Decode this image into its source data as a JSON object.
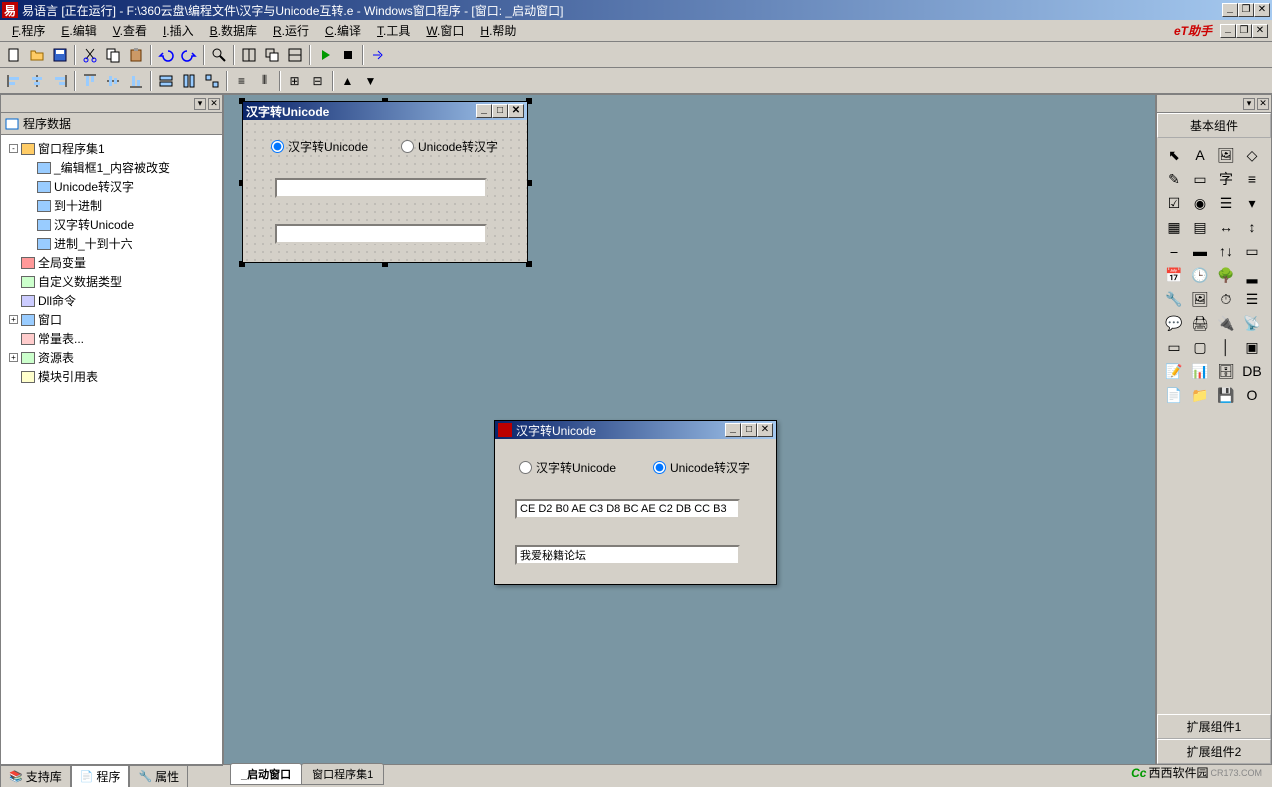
{
  "title": "易语言 [正在运行] - F:\\360云盘\\编程文件\\汉字与Unicode互转.e - Windows窗口程序 - [窗口: _启动窗口]",
  "menubar": {
    "items": [
      {
        "u": "F",
        "label": ".程序"
      },
      {
        "u": "E",
        "label": ".编辑"
      },
      {
        "u": "V",
        "label": ".查看"
      },
      {
        "u": "I",
        "label": ".插入"
      },
      {
        "u": "B",
        "label": ".数据库"
      },
      {
        "u": "R",
        "label": ".运行"
      },
      {
        "u": "C",
        "label": ".编译"
      },
      {
        "u": "T",
        "label": ".工具"
      },
      {
        "u": "W",
        "label": ".窗口"
      },
      {
        "u": "H",
        "label": ".帮助"
      }
    ],
    "helper": "eT助手"
  },
  "left_panel": {
    "title": "程序数据",
    "tree": [
      {
        "indent": 0,
        "toggle": "-",
        "icon": "folder",
        "label": "窗口程序集1"
      },
      {
        "indent": 1,
        "toggle": "",
        "icon": "sub",
        "label": "_编辑框1_内容被改变"
      },
      {
        "indent": 1,
        "toggle": "",
        "icon": "sub",
        "label": "Unicode转汉字"
      },
      {
        "indent": 1,
        "toggle": "",
        "icon": "sub",
        "label": "到十进制"
      },
      {
        "indent": 1,
        "toggle": "",
        "icon": "sub",
        "label": "汉字转Unicode"
      },
      {
        "indent": 1,
        "toggle": "",
        "icon": "sub",
        "label": "进制_十到十六"
      },
      {
        "indent": 0,
        "toggle": "",
        "icon": "var",
        "label": "全局变量"
      },
      {
        "indent": 0,
        "toggle": "",
        "icon": "type",
        "label": "自定义数据类型"
      },
      {
        "indent": 0,
        "toggle": "",
        "icon": "dll",
        "label": "Dll命令"
      },
      {
        "indent": 0,
        "toggle": "+",
        "icon": "window",
        "label": "窗口"
      },
      {
        "indent": 0,
        "toggle": "",
        "icon": "const",
        "label": "常量表..."
      },
      {
        "indent": 0,
        "toggle": "+",
        "icon": "res",
        "label": "资源表"
      },
      {
        "indent": 0,
        "toggle": "",
        "icon": "mod",
        "label": "模块引用表"
      }
    ]
  },
  "design_form": {
    "title": "汉字转Unicode",
    "radio1": "汉字转Unicode",
    "radio2": "Unicode转汉字"
  },
  "run_form": {
    "title": "汉字转Unicode",
    "radio1": "汉字转Unicode",
    "radio2": "Unicode转汉字",
    "input1": "CE D2 B0 AE C3 D8 BC AE C2 DB CC B3",
    "input2": "我爱秘籍论坛"
  },
  "right_panel": {
    "title": "基本组件",
    "ext1": "扩展组件1",
    "ext2": "扩展组件2"
  },
  "bottom_tabs_left": [
    "支持库",
    "程序",
    "属性"
  ],
  "bottom_tabs_content": [
    "_启动窗口",
    "窗口程序集1"
  ],
  "watermark": "西西软件园",
  "watermark_url": "CR173.COM"
}
